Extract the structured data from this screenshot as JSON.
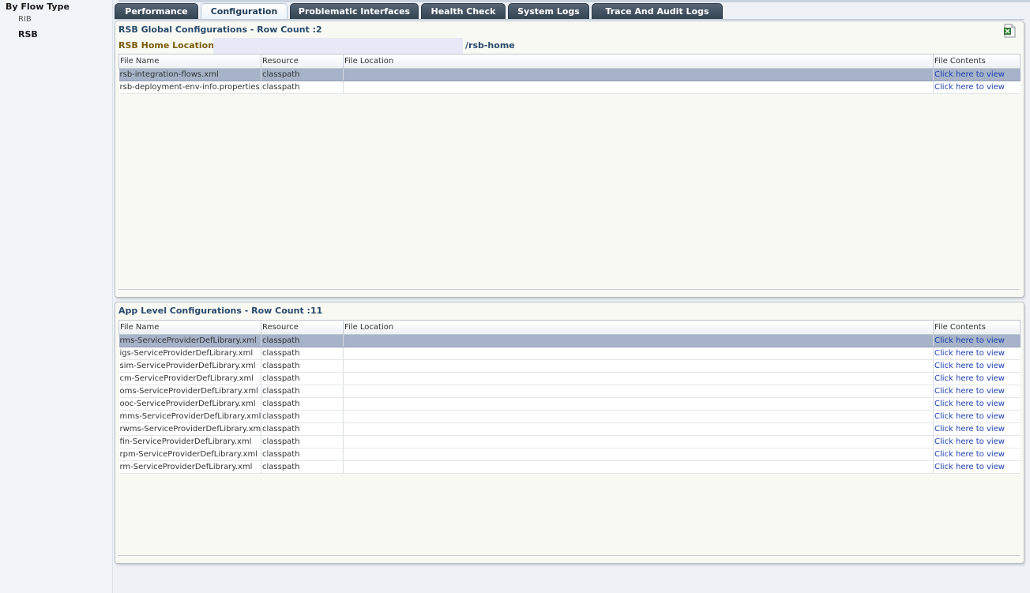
{
  "sidebar": {
    "title": "By Flow Type",
    "items": [
      {
        "label": "RIB",
        "selected": false
      },
      {
        "label": "RSB",
        "selected": true
      }
    ]
  },
  "tabs": [
    {
      "label": "Performance",
      "active": false
    },
    {
      "label": "Configuration",
      "active": true
    },
    {
      "label": "Problematic Interfaces",
      "active": false
    },
    {
      "label": "Health Check",
      "active": false
    },
    {
      "label": "System Logs",
      "active": false
    },
    {
      "label": "Trace And Audit Logs",
      "active": false
    }
  ],
  "global": {
    "title": "RSB Global Configurations - Row Count :2",
    "home_label": "RSB Home Location :",
    "home_value": "",
    "home_suffix": "/rsb-home",
    "export_icon": "excel-export-icon",
    "columns": [
      "File Name",
      "Resource",
      "File Location",
      "File Contents"
    ],
    "rows": [
      {
        "file_name": "rsb-integration-flows.xml",
        "resource": "classpath",
        "location": "",
        "contents": "Click here to view",
        "selected": true
      },
      {
        "file_name": "rsb-deployment-env-info.properties",
        "resource": "classpath",
        "location": "",
        "contents": "Click here to view",
        "selected": false
      }
    ]
  },
  "app": {
    "title": "App Level Configurations - Row Count :11",
    "columns": [
      "File Name",
      "Resource",
      "File Location",
      "File Contents"
    ],
    "rows": [
      {
        "file_name": "rms-ServiceProviderDefLibrary.xml",
        "resource": "classpath",
        "location": "",
        "contents": "Click here to view",
        "selected": true
      },
      {
        "file_name": "igs-ServiceProviderDefLibrary.xml",
        "resource": "classpath",
        "location": "",
        "contents": "Click here to view",
        "selected": false
      },
      {
        "file_name": "sim-ServiceProviderDefLibrary.xml",
        "resource": "classpath",
        "location": "",
        "contents": "Click here to view",
        "selected": false
      },
      {
        "file_name": "cm-ServiceProviderDefLibrary.xml",
        "resource": "classpath",
        "location": "",
        "contents": "Click here to view",
        "selected": false
      },
      {
        "file_name": "oms-ServiceProviderDefLibrary.xml",
        "resource": "classpath",
        "location": "",
        "contents": "Click here to view",
        "selected": false
      },
      {
        "file_name": "ooc-ServiceProviderDefLibrary.xml",
        "resource": "classpath",
        "location": "",
        "contents": "Click here to view",
        "selected": false
      },
      {
        "file_name": "mms-ServiceProviderDefLibrary.xml",
        "resource": "classpath",
        "location": "",
        "contents": "Click here to view",
        "selected": false
      },
      {
        "file_name": "rwms-ServiceProviderDefLibrary.xml",
        "resource": "classpath",
        "location": "",
        "contents": "Click here to view",
        "selected": false
      },
      {
        "file_name": "fin-ServiceProviderDefLibrary.xml",
        "resource": "classpath",
        "location": "",
        "contents": "Click here to view",
        "selected": false
      },
      {
        "file_name": "rpm-ServiceProviderDefLibrary.xml",
        "resource": "classpath",
        "location": "",
        "contents": "Click here to view",
        "selected": false
      },
      {
        "file_name": "rm-ServiceProviderDefLibrary.xml",
        "resource": "classpath",
        "location": "",
        "contents": "Click here to view",
        "selected": false
      }
    ]
  },
  "colors": {
    "tab_dark": "#344352",
    "selected_row": "#a6b3c8",
    "panel_title": "#274a6b",
    "home_label": "#7a5c08",
    "link": "#1a3fb0"
  }
}
